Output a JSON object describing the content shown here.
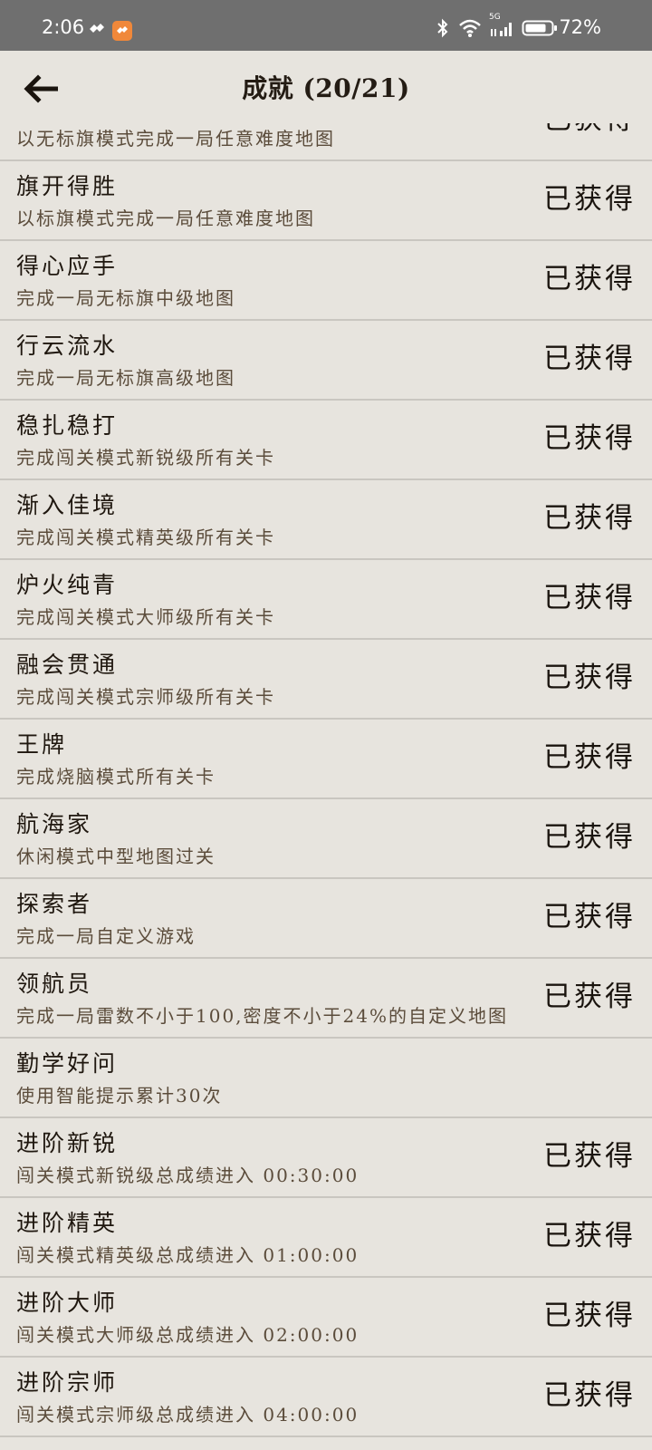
{
  "status_bar": {
    "time": "2:06",
    "network": "5G",
    "battery": "72%"
  },
  "header": {
    "title": "成就 (20/21)"
  },
  "achievements": [
    {
      "name": "",
      "desc": "以无标旗模式完成一局任意难度地图",
      "status": "已获得"
    },
    {
      "name": "旗开得胜",
      "desc": "以标旗模式完成一局任意难度地图",
      "status": "已获得"
    },
    {
      "name": "得心应手",
      "desc": "完成一局无标旗中级地图",
      "status": "已获得"
    },
    {
      "name": "行云流水",
      "desc": "完成一局无标旗高级地图",
      "status": "已获得"
    },
    {
      "name": "稳扎稳打",
      "desc": "完成闯关模式新锐级所有关卡",
      "status": "已获得"
    },
    {
      "name": "渐入佳境",
      "desc": "完成闯关模式精英级所有关卡",
      "status": "已获得"
    },
    {
      "name": "炉火纯青",
      "desc": "完成闯关模式大师级所有关卡",
      "status": "已获得"
    },
    {
      "name": "融会贯通",
      "desc": "完成闯关模式宗师级所有关卡",
      "status": "已获得"
    },
    {
      "name": "王牌",
      "desc": "完成烧脑模式所有关卡",
      "status": "已获得"
    },
    {
      "name": "航海家",
      "desc": "休闲模式中型地图过关",
      "status": "已获得"
    },
    {
      "name": "探索者",
      "desc": "完成一局自定义游戏",
      "status": "已获得"
    },
    {
      "name": "领航员",
      "desc": "完成一局雷数不小于100,密度不小于24%的自定义地图",
      "status": "已获得"
    },
    {
      "name": "勤学好问",
      "desc": "使用智能提示累计30次",
      "status": ""
    },
    {
      "name": "进阶新锐",
      "desc": "闯关模式新锐级总成绩进入 00:30:00",
      "status": "已获得"
    },
    {
      "name": "进阶精英",
      "desc": "闯关模式精英级总成绩进入 01:00:00",
      "status": "已获得"
    },
    {
      "name": "进阶大师",
      "desc": "闯关模式大师级总成绩进入 02:00:00",
      "status": "已获得"
    },
    {
      "name": "进阶宗师",
      "desc": "闯关模式宗师级总成绩进入 04:00:00",
      "status": "已获得"
    }
  ]
}
